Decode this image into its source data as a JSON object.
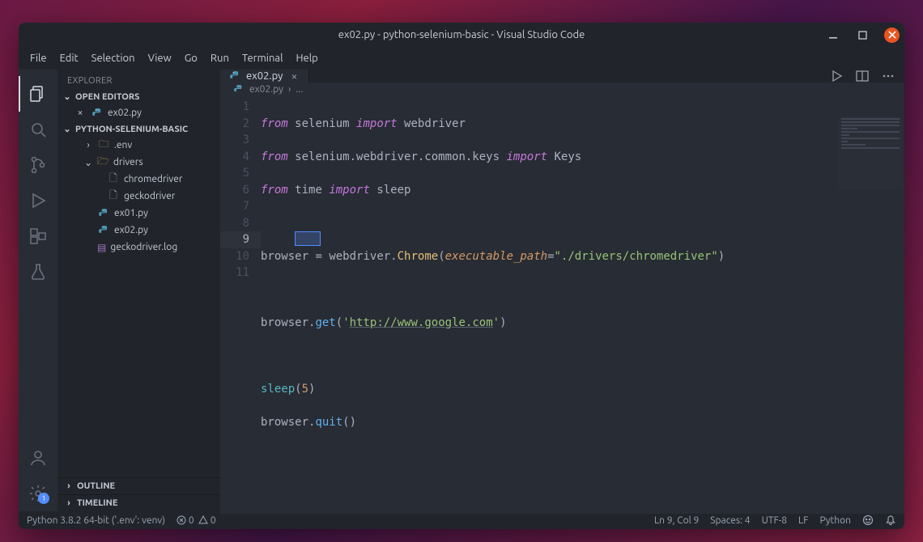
{
  "window": {
    "title": "ex02.py - python-selenium-basic - Visual Studio Code"
  },
  "menu": [
    "File",
    "Edit",
    "Selection",
    "View",
    "Go",
    "Run",
    "Terminal",
    "Help"
  ],
  "sidebar": {
    "title": "EXPLORER",
    "sections": {
      "open_editors": {
        "label": "OPEN EDITORS",
        "items": [
          {
            "name": "ex02.py"
          }
        ]
      },
      "project": {
        "label": "PYTHON-SELENIUM-BASIC",
        "tree": [
          {
            "kind": "folder-closed",
            "name": ".env",
            "depth": 1
          },
          {
            "kind": "folder-open",
            "name": "drivers",
            "depth": 1
          },
          {
            "kind": "file",
            "name": "chromedriver",
            "depth": 2
          },
          {
            "kind": "file",
            "name": "geckodriver",
            "depth": 2
          },
          {
            "kind": "py",
            "name": "ex01.py",
            "depth": 1
          },
          {
            "kind": "py",
            "name": "ex02.py",
            "depth": 1
          },
          {
            "kind": "log",
            "name": "geckodriver.log",
            "depth": 1
          }
        ]
      },
      "outline": {
        "label": "OUTLINE"
      },
      "timeline": {
        "label": "TIMELINE"
      }
    }
  },
  "tabs": {
    "active": "ex02.py"
  },
  "breadcrumb": {
    "file": "ex02.py",
    "rest": "..."
  },
  "code": {
    "lines": 11,
    "current_line": 9,
    "tokens": {
      "l1": {
        "from": "from",
        "mod": "selenium",
        "import": "import",
        "what": "webdriver"
      },
      "l2": {
        "from": "from",
        "mod": "selenium.webdriver.common.keys",
        "import": "import",
        "what": "Keys"
      },
      "l3": {
        "from": "from",
        "mod": "time",
        "import": "import",
        "what": "sleep"
      },
      "l5_var": "browser",
      "l5_eq": " = ",
      "l5_mod": "webdriver",
      "l5_dot": ".",
      "l5_cls": "Chrome",
      "l5_par": "executable_path",
      "l5_eq2": "=",
      "l5_str": "\"./drivers/chromedriver\"",
      "l7_obj": "browser",
      "l7_dot": ".",
      "l7_fn": "get",
      "l7_op": "(",
      "l7_q": "'",
      "l7_url": "http://www.google.com",
      "l7_q2": "'",
      "l7_cp": ")",
      "l9_fn": "sleep",
      "l9_op": "(",
      "l9_num": "5",
      "l9_cp": ")",
      "l10_obj": "browser",
      "l10_dot": ".",
      "l10_fn": "quit",
      "l10_op": "()"
    }
  },
  "status": {
    "python": "Python 3.8.2 64-bit ('.env': venv)",
    "errors": "0",
    "warnings": "0",
    "ln_col": "Ln 9, Col 9",
    "spaces": "Spaces: 4",
    "encoding": "UTF-8",
    "eol": "LF",
    "lang": "Python"
  },
  "settings_badge": "1"
}
